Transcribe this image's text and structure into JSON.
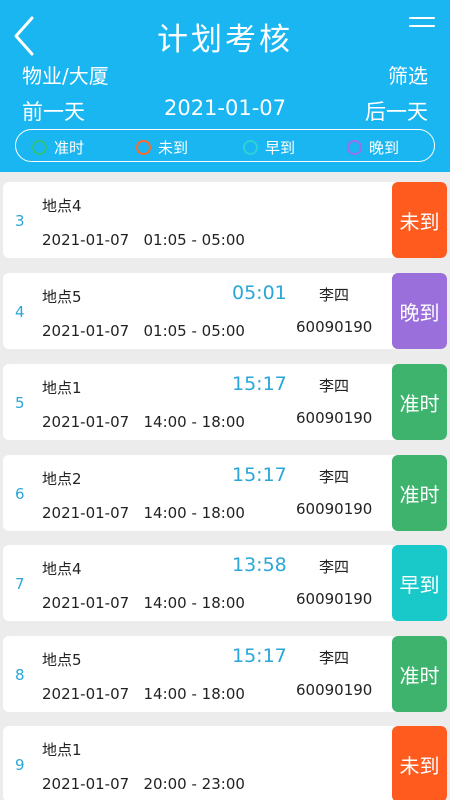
{
  "header": {
    "title": "计划考核",
    "site": "物业/大厦",
    "filter_label": "筛选",
    "prev_day_label": "前一天",
    "date": "2021-01-07",
    "next_day_label": "后一天",
    "back_icon": "chevron-left-icon",
    "menu_icon": "menu-icon",
    "background_color": "#1ab6f2"
  },
  "legend": [
    {
      "label": "准时",
      "color": "#2ec27e"
    },
    {
      "label": "未到",
      "color": "#ff6a2b"
    },
    {
      "label": "早到",
      "color": "#2fd1d6"
    },
    {
      "label": "晚到",
      "color": "#9b6df0"
    }
  ],
  "records": [
    {
      "index": "3",
      "place": "地点4",
      "date": "2021-01-07",
      "window": "01:05 - 05:00",
      "time": "",
      "person": "",
      "person_id": "",
      "status": "未到",
      "status_color": "#ff5b1f"
    },
    {
      "index": "4",
      "place": "地点5",
      "date": "2021-01-07",
      "window": "01:05 - 05:00",
      "time": "05:01",
      "person": "李四",
      "person_id": "60090190",
      "status": "晚到",
      "status_color": "#9b6fdb"
    },
    {
      "index": "5",
      "place": "地点1",
      "date": "2021-01-07",
      "window": "14:00 - 18:00",
      "time": "15:17",
      "person": "李四",
      "person_id": "60090190",
      "status": "准时",
      "status_color": "#3db36e"
    },
    {
      "index": "6",
      "place": "地点2",
      "date": "2021-01-07",
      "window": "14:00 - 18:00",
      "time": "15:17",
      "person": "李四",
      "person_id": "60090190",
      "status": "准时",
      "status_color": "#3db36e"
    },
    {
      "index": "7",
      "place": "地点4",
      "date": "2021-01-07",
      "window": "14:00 - 18:00",
      "time": "13:58",
      "person": "李四",
      "person_id": "60090190",
      "status": "早到",
      "status_color": "#19c8c8"
    },
    {
      "index": "8",
      "place": "地点5",
      "date": "2021-01-07",
      "window": "14:00 - 18:00",
      "time": "15:17",
      "person": "李四",
      "person_id": "60090190",
      "status": "准时",
      "status_color": "#3db36e"
    },
    {
      "index": "9",
      "place": "地点1",
      "date": "2021-01-07",
      "window": "20:00 - 23:00",
      "time": "",
      "person": "",
      "person_id": "",
      "status": "未到",
      "status_color": "#ff5b1f"
    }
  ]
}
